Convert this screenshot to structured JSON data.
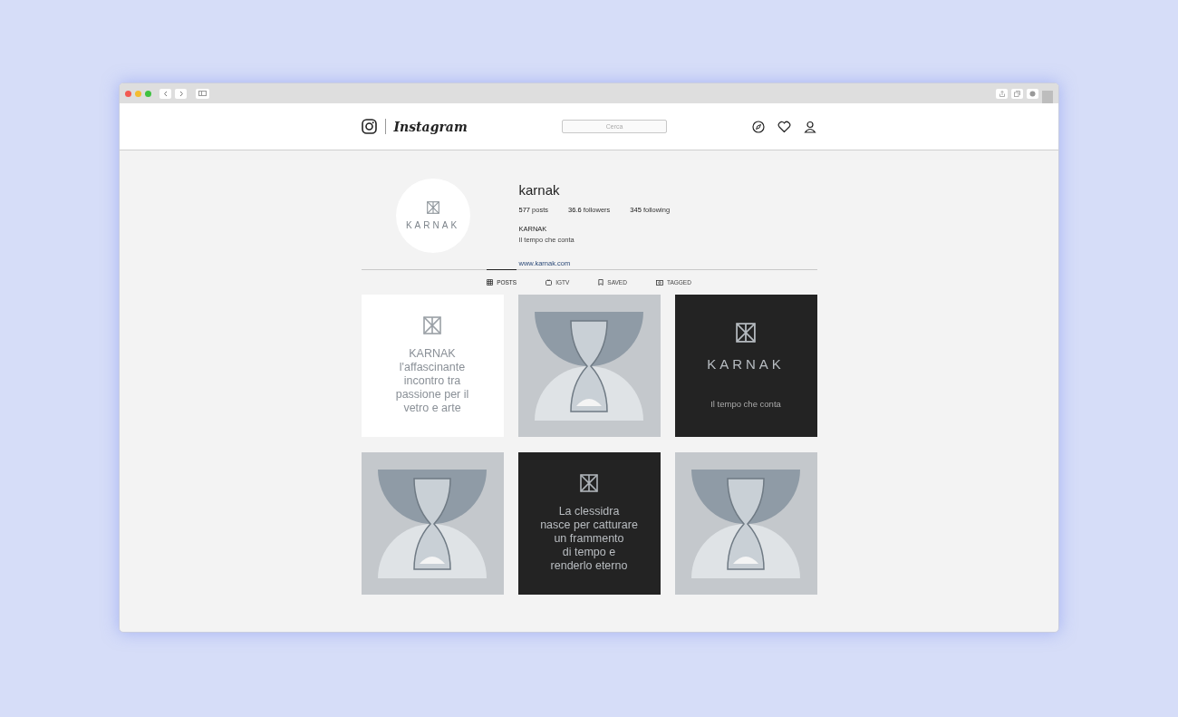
{
  "header": {
    "logo_text": "Instagram",
    "search": {
      "placeholder": "Cerca"
    }
  },
  "profile": {
    "avatar_text": "KARNAK",
    "username": "karnak",
    "stats": [
      "**577** posts",
      "**36.6** followers",
      "**345** following"
    ],
    "name": "KARNAK",
    "bio": "Il tempo che conta",
    "link": "www.karnak.com"
  },
  "tabs": [
    {
      "label": "POSTS",
      "selected": true
    },
    {
      "label": "IGTV",
      "selected": false
    },
    {
      "label": "SAVED",
      "selected": false
    },
    {
      "label": "TAGGED",
      "selected": false
    }
  ],
  "posts": [
    {
      "kind": "quote",
      "dark": false,
      "text": "KARNAK\nl'affascinante\nincontro tra\npassione per il\nvetro e arte"
    },
    {
      "kind": "photo"
    },
    {
      "kind": "brand",
      "dark": true,
      "wordmark": "KARNAK",
      "tagline": "Il tempo che conta"
    },
    {
      "kind": "photo"
    },
    {
      "kind": "quote",
      "dark": true,
      "text": "La clessidra\nnasce per catturare\nun frammento\ndi tempo e\nrenderlo eterno"
    },
    {
      "kind": "photo"
    }
  ]
}
